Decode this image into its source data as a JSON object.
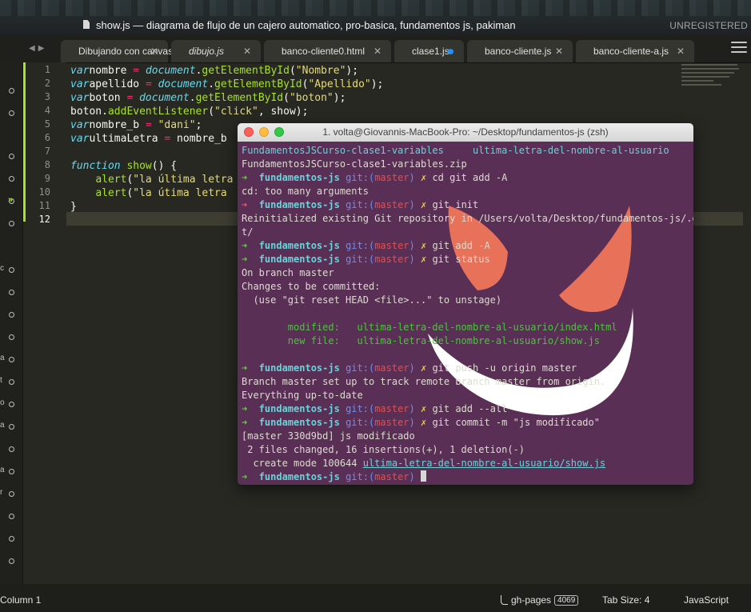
{
  "window": {
    "title": "show.js — diagrama de flujo de un cajero automatico, pro-basica, fundamentos js, pakiman",
    "unregistered": "UNREGISTERED"
  },
  "tabs": [
    {
      "label": "Dibujando con canvas.html",
      "italic": false,
      "state": "close"
    },
    {
      "label": "dibujo.js",
      "italic": true,
      "state": "close"
    },
    {
      "label": "banco-cliente0.html",
      "italic": false,
      "state": "close"
    },
    {
      "label": "clase1.js",
      "italic": false,
      "state": "modified"
    },
    {
      "label": "banco-cliente.js",
      "italic": false,
      "state": "close"
    },
    {
      "label": "banco-cliente-a.js",
      "italic": false,
      "state": "close"
    }
  ],
  "sidebar_fragments": [
    "c",
    "a",
    "t",
    "o",
    "a",
    "a",
    "r"
  ],
  "editor": {
    "line_numbers": [
      "1",
      "2",
      "3",
      "4",
      "5",
      "6",
      "7",
      "8",
      "9",
      "10",
      "11",
      "12"
    ],
    "lines": [
      [
        [
          "kw",
          "var"
        ],
        [
          "",
          "nombre "
        ],
        [
          "op",
          "="
        ],
        [
          "",
          " "
        ],
        [
          "obj",
          "document"
        ],
        [
          "",
          "."
        ],
        [
          "fn",
          "getElementById"
        ],
        [
          "",
          "("
        ],
        [
          "str",
          "\"Nombre\""
        ],
        [
          "",
          ");"
        ]
      ],
      [
        [
          "kw",
          "var"
        ],
        [
          "",
          "apellido "
        ],
        [
          "op",
          "="
        ],
        [
          "",
          " "
        ],
        [
          "obj",
          "document"
        ],
        [
          "",
          "."
        ],
        [
          "fn",
          "getElementById"
        ],
        [
          "",
          "("
        ],
        [
          "str",
          "\"Apellido\""
        ],
        [
          "",
          ");"
        ]
      ],
      [
        [
          "kw",
          "var"
        ],
        [
          "",
          "boton "
        ],
        [
          "op",
          "="
        ],
        [
          "",
          " "
        ],
        [
          "obj",
          "document"
        ],
        [
          "",
          "."
        ],
        [
          "fn",
          "getElementById"
        ],
        [
          "",
          "("
        ],
        [
          "str",
          "\"boton\""
        ],
        [
          "",
          ");"
        ]
      ],
      [
        [
          "",
          "boton."
        ],
        [
          "fn",
          "addEventListener"
        ],
        [
          "",
          "("
        ],
        [
          "str",
          "\"click\""
        ],
        [
          "",
          ", show);"
        ]
      ],
      [
        [
          "kw",
          "var"
        ],
        [
          "",
          "nombre_b "
        ],
        [
          "op",
          "="
        ],
        [
          "",
          " "
        ],
        [
          "str",
          "\"dani\""
        ],
        [
          "",
          ";"
        ]
      ],
      [
        [
          "kw",
          "var"
        ],
        [
          "",
          "ultimaLetra "
        ],
        [
          "op",
          "="
        ],
        [
          "",
          " nombre_b"
        ]
      ],
      [],
      [
        [
          "kw",
          "function"
        ],
        [
          "",
          " "
        ],
        [
          "fn",
          "show"
        ],
        [
          "",
          "() {"
        ]
      ],
      [
        [
          "",
          "    "
        ],
        [
          "fn",
          "alert"
        ],
        [
          "",
          "("
        ],
        [
          "str",
          "\"la última letra"
        ]
      ],
      [
        [
          "",
          "    "
        ],
        [
          "fn",
          "alert"
        ],
        [
          "",
          "("
        ],
        [
          "str",
          "\"la útima letra"
        ]
      ],
      [
        [
          "",
          "}"
        ]
      ],
      []
    ]
  },
  "terminal": {
    "title": "1. volta@Giovannis-MacBook-Pro: ~/Desktop/fundamentos-js (zsh)",
    "lines": [
      [
        [
          "t-teal",
          "FundamentosJSCurso-clase1-variables     ultima-letra-del-nombre-al-usuario"
        ]
      ],
      [
        [
          "",
          "FundamentosJSCurso-clase1-variables.zip"
        ]
      ],
      [
        [
          "t-green",
          "➜  "
        ],
        [
          "t-dir",
          "fundamentos-js "
        ],
        [
          "t-git",
          "git:("
        ],
        [
          "t-br",
          "master"
        ],
        [
          "t-git",
          ") "
        ],
        [
          "t-x",
          "✗ "
        ],
        [
          "",
          "cd git add -A"
        ]
      ],
      [
        [
          "",
          "cd: too many arguments"
        ]
      ],
      [
        [
          "t-red",
          "➜  "
        ],
        [
          "t-dir",
          "fundamentos-js "
        ],
        [
          "t-git",
          "git:("
        ],
        [
          "t-br",
          "master"
        ],
        [
          "t-git",
          ") "
        ],
        [
          "t-x",
          "✗ "
        ],
        [
          "",
          "git init"
        ]
      ],
      [
        [
          "",
          "Reinitialized existing Git repository in /Users/volta/Desktop/fundamentos-js/.gi"
        ]
      ],
      [
        [
          "",
          "t/"
        ]
      ],
      [
        [
          "t-green",
          "➜  "
        ],
        [
          "t-dir",
          "fundamentos-js "
        ],
        [
          "t-git",
          "git:("
        ],
        [
          "t-br",
          "master"
        ],
        [
          "t-git",
          ") "
        ],
        [
          "t-x",
          "✗ "
        ],
        [
          "",
          "git add -A"
        ]
      ],
      [
        [
          "t-green",
          "➜  "
        ],
        [
          "t-dir",
          "fundamentos-js "
        ],
        [
          "t-git",
          "git:("
        ],
        [
          "t-br",
          "master"
        ],
        [
          "t-git",
          ") "
        ],
        [
          "t-x",
          "✗ "
        ],
        [
          "",
          "git status"
        ]
      ],
      [
        [
          "",
          "On branch master"
        ]
      ],
      [
        [
          "",
          "Changes to be committed:"
        ]
      ],
      [
        [
          "",
          "  (use \"git reset HEAD <file>...\" to unstage)"
        ]
      ],
      [],
      [
        [
          "t-mod",
          "        modified:   ultima-letra-del-nombre-al-usuario/index.html"
        ]
      ],
      [
        [
          "t-mod",
          "        new file:   ultima-letra-del-nombre-al-usuario/show.js"
        ]
      ],
      [],
      [
        [
          "t-green",
          "➜  "
        ],
        [
          "t-dir",
          "fundamentos-js "
        ],
        [
          "t-git",
          "git:("
        ],
        [
          "t-br",
          "master"
        ],
        [
          "t-git",
          ") "
        ],
        [
          "t-x",
          "✗ "
        ],
        [
          "",
          "git push -u origin master"
        ]
      ],
      [
        [
          "",
          "Branch master set up to track remote branch master from origin."
        ]
      ],
      [
        [
          "",
          "Everything up-to-date"
        ]
      ],
      [
        [
          "t-green",
          "➜  "
        ],
        [
          "t-dir",
          "fundamentos-js "
        ],
        [
          "t-git",
          "git:("
        ],
        [
          "t-br",
          "master"
        ],
        [
          "t-git",
          ") "
        ],
        [
          "t-x",
          "✗ "
        ],
        [
          "",
          "git add --all"
        ]
      ],
      [
        [
          "t-green",
          "➜  "
        ],
        [
          "t-dir",
          "fundamentos-js "
        ],
        [
          "t-git",
          "git:("
        ],
        [
          "t-br",
          "master"
        ],
        [
          "t-git",
          ") "
        ],
        [
          "t-x",
          "✗ "
        ],
        [
          "",
          "git commit -m \"js modificado\""
        ]
      ],
      [
        [
          "",
          "[master 330d9bd] js modificado"
        ]
      ],
      [
        [
          "",
          "",
          " 2 files changed, 16 insertions(+), 1 deletion(-)"
        ]
      ],
      [
        [
          "",
          "  create mode 100644 "
        ],
        [
          "t-ul",
          "ultima-letra-del-nombre-al-usuario/show.js"
        ]
      ],
      [
        [
          "t-green",
          "➜  "
        ],
        [
          "t-dir",
          "fundamentos-js "
        ],
        [
          "t-git",
          "git:("
        ],
        [
          "t-br",
          "master"
        ],
        [
          "t-git",
          ") "
        ],
        [
          "cursor",
          ""
        ]
      ]
    ]
  },
  "statusbar": {
    "position": "Column 1",
    "branch": "gh-pages",
    "branch_count": "4069",
    "tab_size": "Tab Size: 4",
    "syntax": "JavaScript"
  },
  "colors": {
    "editor_bg": "#272822",
    "terminal_bg": "#5a2f56",
    "accent_tab_dot": "#1e90ff"
  }
}
